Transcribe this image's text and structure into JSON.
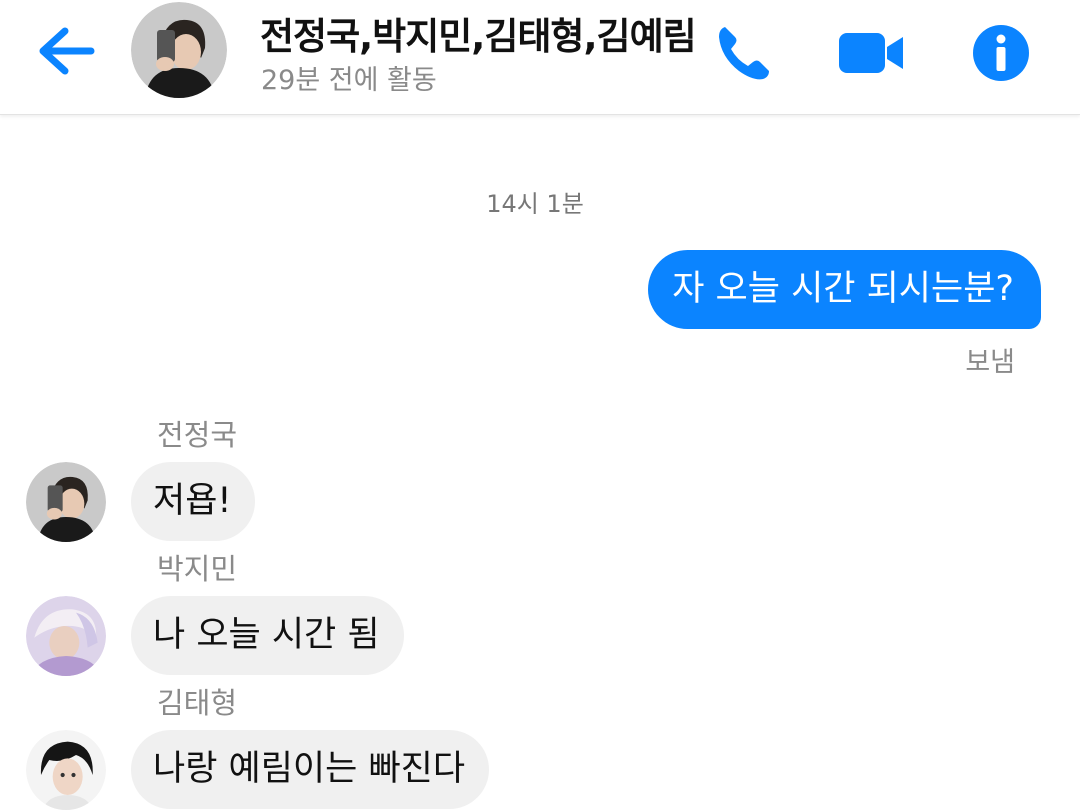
{
  "header": {
    "title": "전정국,박지민,김태형,김예림",
    "subtitle": "29분 전에 활동",
    "back_icon": "arrow-left-icon",
    "call_icon": "phone-icon",
    "video_icon": "video-camera-icon",
    "info_icon": "info-icon",
    "accent_color": "#0b84ff"
  },
  "conversation": {
    "timestamp": "14시 1분",
    "outgoing": {
      "text": "자 오늘 시간 되시는분?",
      "status": "보냄"
    },
    "incoming": [
      {
        "sender": "전정국",
        "text": "저욥!"
      },
      {
        "sender": "박지민",
        "text": "나 오늘 시간 됨"
      },
      {
        "sender": "김태형",
        "text": "나랑 예림이는 빠진다"
      }
    ]
  }
}
